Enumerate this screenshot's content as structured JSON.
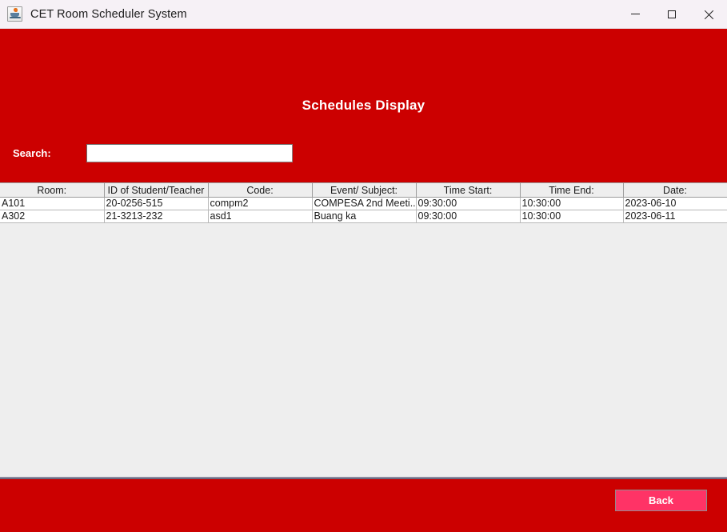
{
  "window": {
    "title": "CET Room Scheduler System",
    "icon": "java-coffee-cup-icon",
    "controls": {
      "minimize": "minimize-icon",
      "maximize": "maximize-icon",
      "close": "close-icon"
    }
  },
  "colors": {
    "header_red": "#CC0000",
    "footer_red": "#CC0000",
    "button_pink": "#FF3366",
    "content_gray": "#EEEEEE",
    "titlebar": "#F6F1F6"
  },
  "header": {
    "title": "Schedules Display",
    "search_label": "Search:",
    "search_value": "",
    "search_placeholder": ""
  },
  "table": {
    "columns": [
      "Room:",
      "ID of Student/Teacher",
      "Code:",
      "Event/ Subject:",
      "Time Start:",
      "Time End:",
      "Date:"
    ],
    "rows": [
      {
        "room": "A101",
        "id": "20-0256-515",
        "code": "compm2",
        "event": "COMPESA 2nd Meeti...",
        "time_start": "09:30:00",
        "time_end": "10:30:00",
        "date": "2023-06-10"
      },
      {
        "room": "A302",
        "id": "21-3213-232",
        "code": "asd1",
        "event": "Buang ka",
        "time_start": "09:30:00",
        "time_end": "10:30:00",
        "date": "2023-06-11"
      }
    ]
  },
  "footer": {
    "back_label": "Back"
  }
}
